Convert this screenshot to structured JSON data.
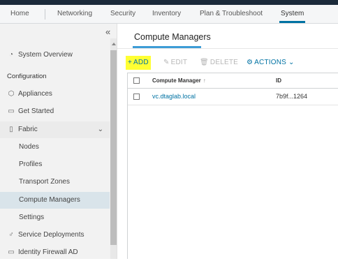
{
  "top_nav": {
    "tabs": [
      {
        "label": "Home"
      },
      {
        "label": "Networking"
      },
      {
        "label": "Security"
      },
      {
        "label": "Inventory"
      },
      {
        "label": "Plan & Troubleshoot"
      },
      {
        "label": "System"
      }
    ],
    "active": "System"
  },
  "sidebar": {
    "collapse_glyph": "«",
    "items": [
      {
        "label": "System Overview",
        "icon": "dashboard-icon"
      },
      {
        "label": "Configuration"
      },
      {
        "label": "Appliances",
        "icon": "appliances-icon"
      },
      {
        "label": "Get Started",
        "icon": "get-started-icon"
      },
      {
        "label": "Fabric",
        "icon": "fabric-icon",
        "expanded": true
      },
      {
        "label": "Nodes"
      },
      {
        "label": "Profiles"
      },
      {
        "label": "Transport Zones"
      },
      {
        "label": "Compute Managers",
        "active": true
      },
      {
        "label": "Settings"
      },
      {
        "label": "Service Deployments",
        "icon": "service-deployments-icon"
      },
      {
        "label": "Identity Firewall AD",
        "icon": "identity-firewall-icon"
      }
    ]
  },
  "main": {
    "page_tab": "Compute Managers",
    "toolbar": {
      "add": "ADD",
      "edit": "EDIT",
      "delete": "DELETE",
      "actions": "ACTIONS"
    },
    "table": {
      "columns": [
        "Compute Manager",
        "ID"
      ],
      "sort_indicator": "↑",
      "rows": [
        {
          "name": "vc.dtaglab.local",
          "id": "7b9f...1264"
        }
      ]
    }
  },
  "colors": {
    "accent": "#0072a3",
    "add_highlight": "#ffff33",
    "active_nav": "#d9e4ea",
    "top_strip": "#1b2a3a"
  }
}
